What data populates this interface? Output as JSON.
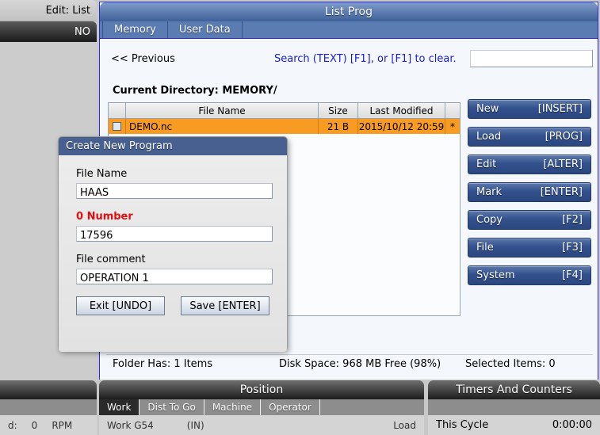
{
  "topleft": {
    "mode_label": "Edit: List",
    "status_label": "NO"
  },
  "window": {
    "title": "List Prog",
    "tabs": [
      {
        "label": "Memory",
        "active": true
      },
      {
        "label": "User Data",
        "active": false
      }
    ]
  },
  "search": {
    "previous_label": "<< Previous",
    "hint": "Search (TEXT) [F1], or [F1] to clear.",
    "value": "",
    "placeholder": ""
  },
  "directory": {
    "label": "Current Directory: MEMORY/"
  },
  "filetable": {
    "columns": [
      "",
      "File Name",
      "Size",
      "Last Modified",
      ""
    ],
    "rows": [
      {
        "checked": false,
        "name": "DEMO.nc",
        "size": "21 B",
        "modified": "2015/10/12 20:59",
        "flag": "*"
      }
    ]
  },
  "buttons": [
    {
      "label": "New",
      "key": "[INSERT]"
    },
    {
      "label": "Load",
      "key": "[PROG]"
    },
    {
      "label": "Edit",
      "key": "[ALTER]"
    },
    {
      "label": "Mark",
      "key": "[ENTER]"
    },
    {
      "label": "Copy",
      "key": "[F2]"
    },
    {
      "label": "File",
      "key": "[F3]"
    },
    {
      "label": "System",
      "key": "[F4]"
    }
  ],
  "status": {
    "folder": "Folder Has: 1 Items",
    "disk": "Disk Space: 968 MB Free (98%)",
    "selected": "Selected Items: 0"
  },
  "dialog": {
    "title": "Create New Program",
    "filename_label": "File Name",
    "filename_value": "HAAS",
    "onumber_label": "0 Number",
    "onumber_value": "17596",
    "comment_label": "File comment",
    "comment_value": "OPERATION 1",
    "exit_label": "Exit [UNDO]",
    "save_label": "Save [ENTER]",
    "required_color": "#e01010"
  },
  "position_panel": {
    "title": "Position",
    "tabs": [
      {
        "label": "Work",
        "active": true
      },
      {
        "label": "Dist To Go",
        "active": false
      },
      {
        "label": "Machine",
        "active": false
      },
      {
        "label": "Operator",
        "active": false
      }
    ],
    "row_left": "Work G54",
    "row_units": "(IN)",
    "row_right": "Load"
  },
  "timers_panel": {
    "title": "Timers And Counters",
    "row_label": "This Cycle",
    "row_value": "0:00:00"
  },
  "spindle_panel": {
    "label": "d:",
    "value": "0",
    "unit": "RPM"
  }
}
